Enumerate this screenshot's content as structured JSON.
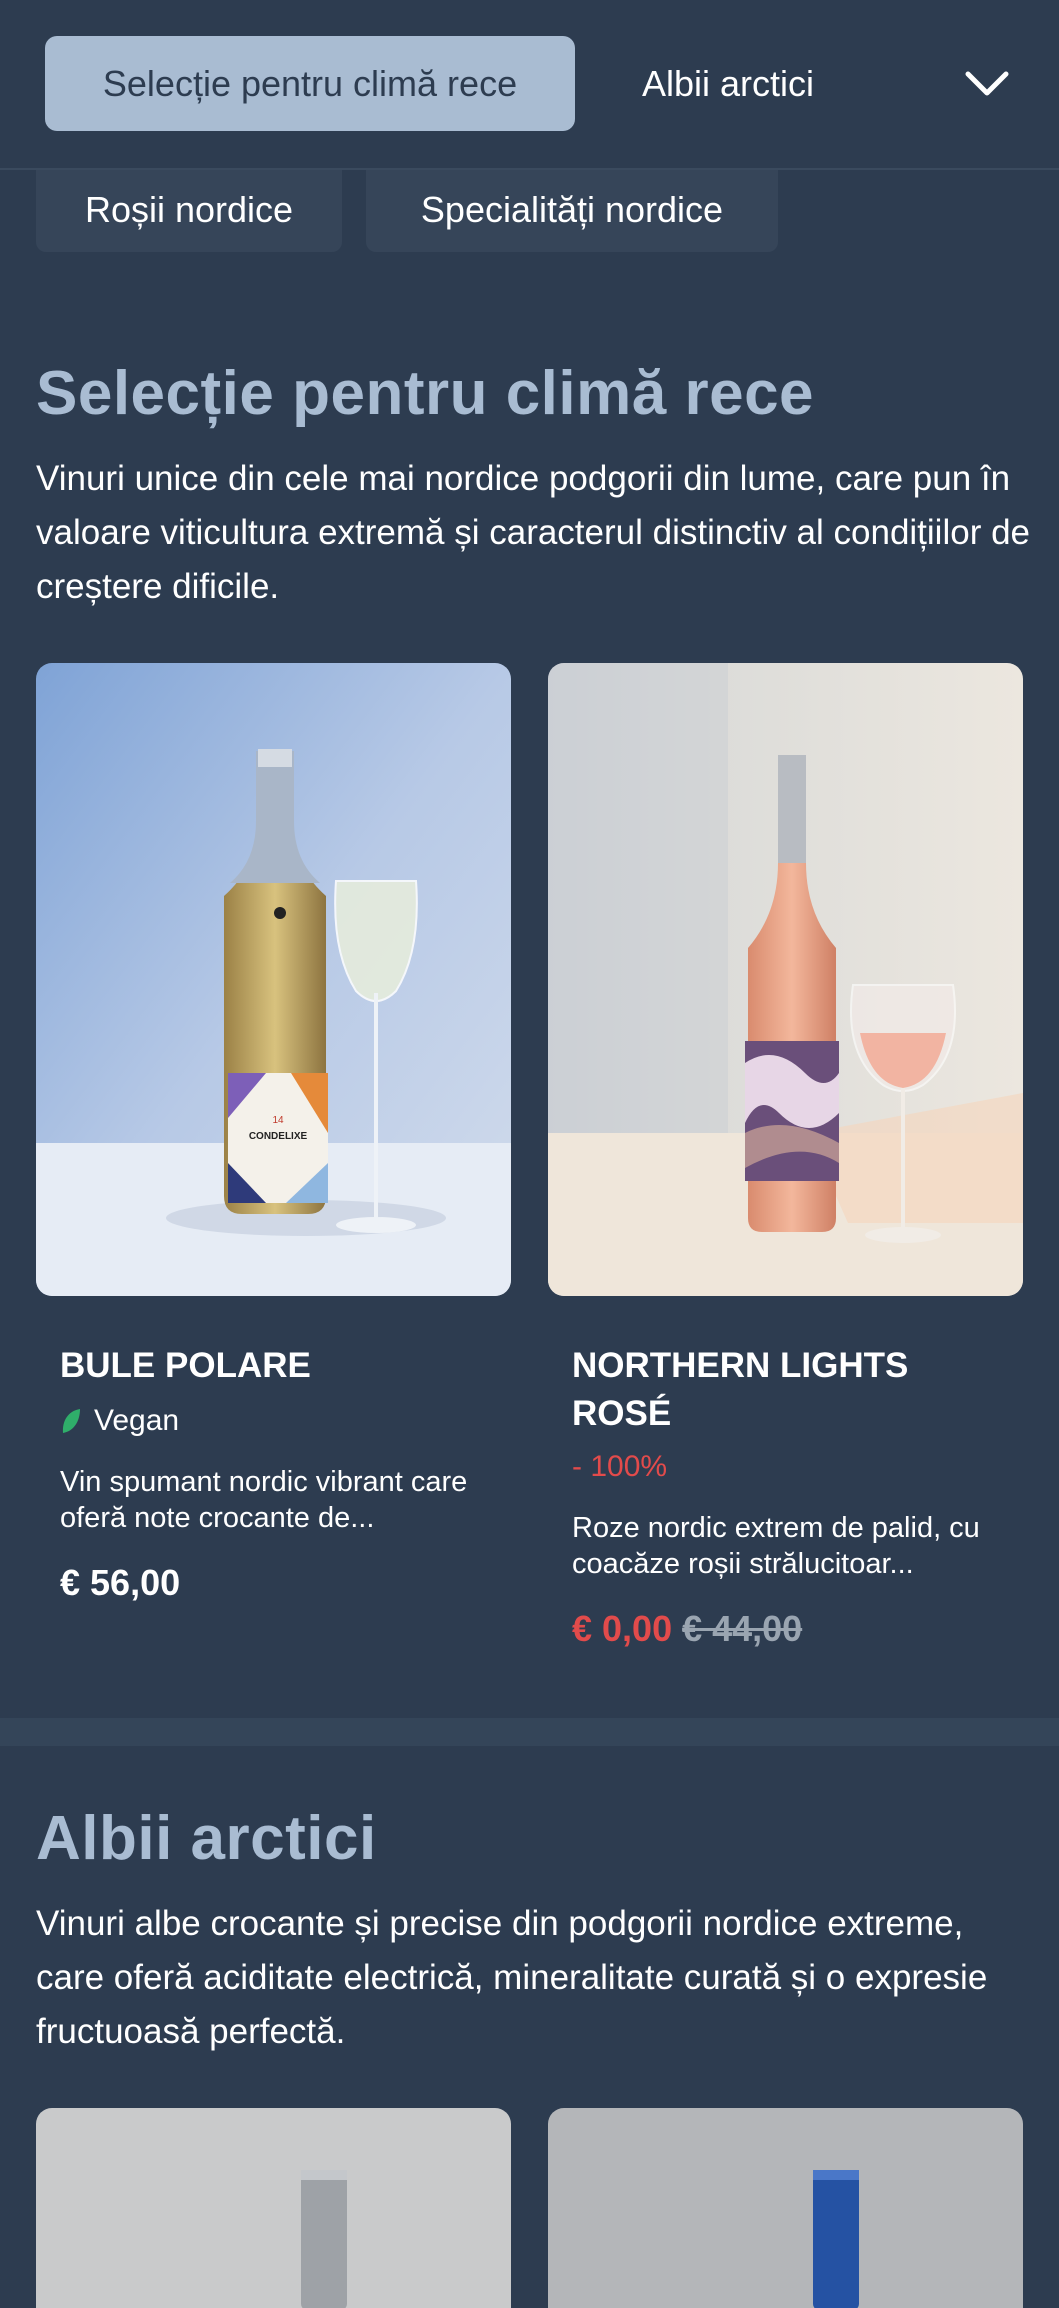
{
  "nav": {
    "active_tab": "Selecție pentru climă rece",
    "tab_2": "Albii arctici",
    "chips": [
      "Roșii nordice",
      "Specialități nordice"
    ]
  },
  "sections": [
    {
      "title": "Selecție pentru climă rece",
      "description": "Vinuri unice din cele mai nordice podgorii din lume, care pun în valoare viticultura extremă și caracterul distinctiv al condițiilor de creștere dificile.",
      "products": [
        {
          "name": "BULE POLARE",
          "badge": "Vegan",
          "badge_icon": "leaf-icon",
          "description": "Vin spumant nordic vibrant care oferă note crocante de...",
          "price": "€ 56,00",
          "label_brand": "CONDELIXE",
          "label_number": "14"
        },
        {
          "name": "NORTHERN LIGHTS ROSÉ",
          "discount": "- 100%",
          "description": "Roze nordic extrem de palid, cu coacăze roșii strălucitoar...",
          "price": "€ 0,00",
          "old_price": "€ 44,00"
        }
      ]
    },
    {
      "title": "Albii arctici",
      "description": "Vinuri albe crocante și precise din podgorii nordice extreme, care oferă aciditate electrică, mineralitate curată și o expresie fructuoasă perfectă."
    }
  ],
  "colors": {
    "background": "#2d3c50",
    "accent": "#a9bcd2",
    "sale": "#e24b4b",
    "vegan": "#2fae6a"
  }
}
